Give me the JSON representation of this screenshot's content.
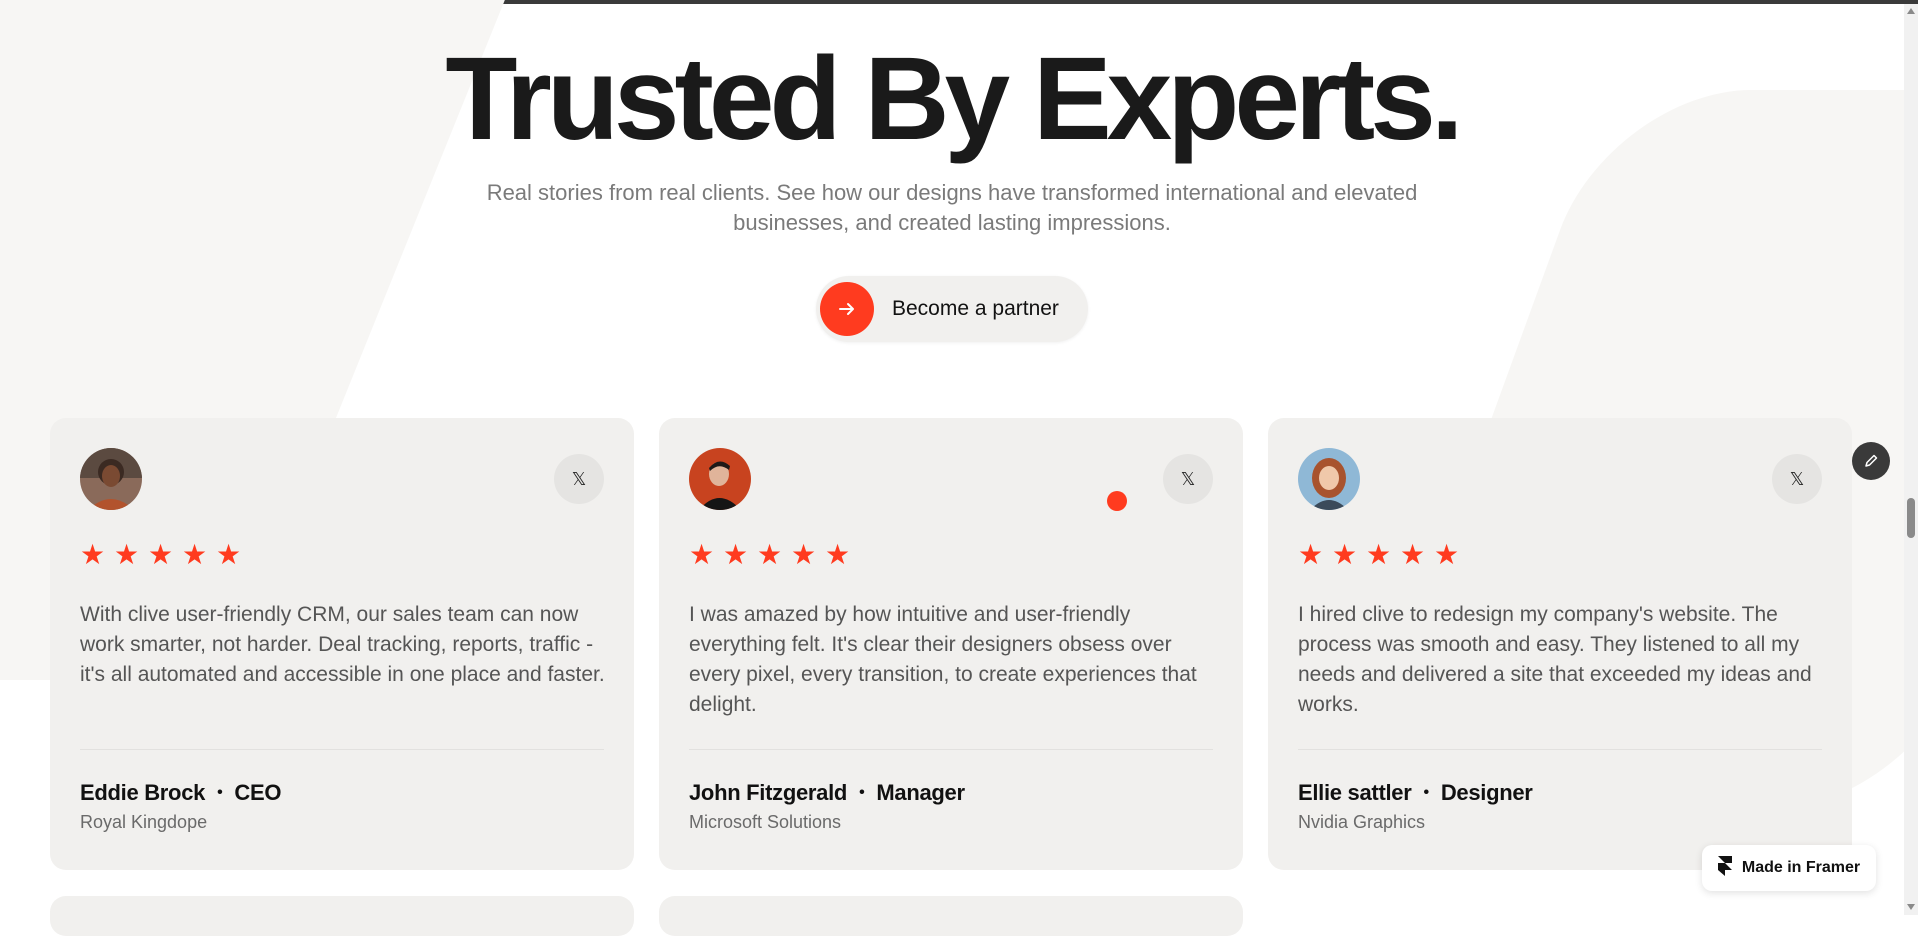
{
  "hero": {
    "title": "Trusted By Experts.",
    "subtitle": "Real stories from real clients. See how our designs have transformed international and elevated businesses, and created lasting impressions.",
    "cta_label": "Become a partner",
    "cta_icon": "arrow-right-icon"
  },
  "colors": {
    "accent": "#ff3b1f",
    "card_bg": "#f1f0ee",
    "text_dark": "#1a1a1a",
    "text_muted": "#7a7a7a"
  },
  "testimonials": [
    {
      "avatar": "avatar-eddie",
      "social_icon": "x-logo-icon",
      "social_glyph": "𝕏",
      "rating": 5,
      "stars": "★ ★ ★ ★ ★",
      "quote": "With clive user-friendly CRM, our sales team can now work smarter, not harder. Deal tracking, reports, traffic - it's all automated and accessible in one place and faster.",
      "name": "Eddie Brock",
      "separator": "•",
      "role": "CEO",
      "company": "Royal Kingdope"
    },
    {
      "avatar": "avatar-john",
      "social_icon": "x-logo-icon",
      "social_glyph": "𝕏",
      "rating": 5,
      "stars": "★ ★ ★ ★ ★",
      "quote": "I was amazed by how intuitive and user-friendly everything felt. It's clear their designers obsess over every pixel, every transition, to create experiences that delight.",
      "name": "John Fitzgerald",
      "separator": "•",
      "role": "Manager",
      "company": "Microsoft Solutions"
    },
    {
      "avatar": "avatar-ellie",
      "social_icon": "x-logo-icon",
      "social_glyph": "𝕏",
      "rating": 5,
      "stars": "★ ★ ★ ★ ★",
      "quote": "I hired clive to redesign my company's website. The process was smooth and easy. They listened to all my needs and delivered a site that exceeded my ideas and works.",
      "name": "Ellie sattler",
      "separator": "•",
      "role": "Designer",
      "company": "Nvidia Graphics"
    }
  ],
  "framer_badge": {
    "label": "Made in Framer",
    "icon": "framer-logo-icon"
  },
  "edit_button_icon": "pencil-icon"
}
